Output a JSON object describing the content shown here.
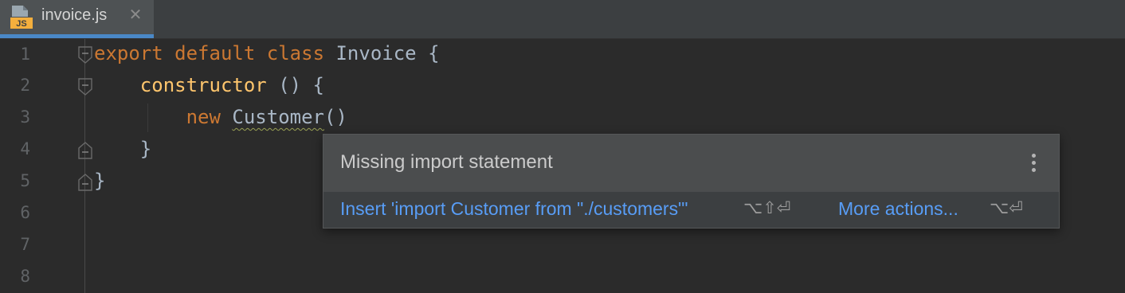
{
  "tab": {
    "icon_label": "JS",
    "title": "invoice.js",
    "close_glyph": "✕"
  },
  "line_numbers": [
    "1",
    "2",
    "3",
    "4",
    "5",
    "6",
    "7",
    "8"
  ],
  "code": {
    "line1": {
      "kw1": "export",
      "kw2": "default",
      "kw3": "class",
      "name": "Invoice",
      "brace": "{"
    },
    "line2": {
      "fn": "constructor",
      "rest": "() {"
    },
    "line3": {
      "kw": "new",
      "cls": "Customer",
      "rest": "()"
    },
    "line4": {
      "text": "}"
    },
    "line5": {
      "text": "}"
    }
  },
  "popup": {
    "title": "Missing import statement",
    "primary_action": "Insert 'import Customer from \"./customers\"'",
    "primary_shortcut": "⌥⇧⏎",
    "secondary_action": "More actions...",
    "secondary_shortcut": "⌥⏎"
  },
  "colors": {
    "background": "#2b2b2b",
    "keyword": "#cc7832",
    "function": "#ffc66d",
    "identifier": "#a9b7c6",
    "link": "#589df6",
    "tab_underline": "#4a88c7"
  }
}
